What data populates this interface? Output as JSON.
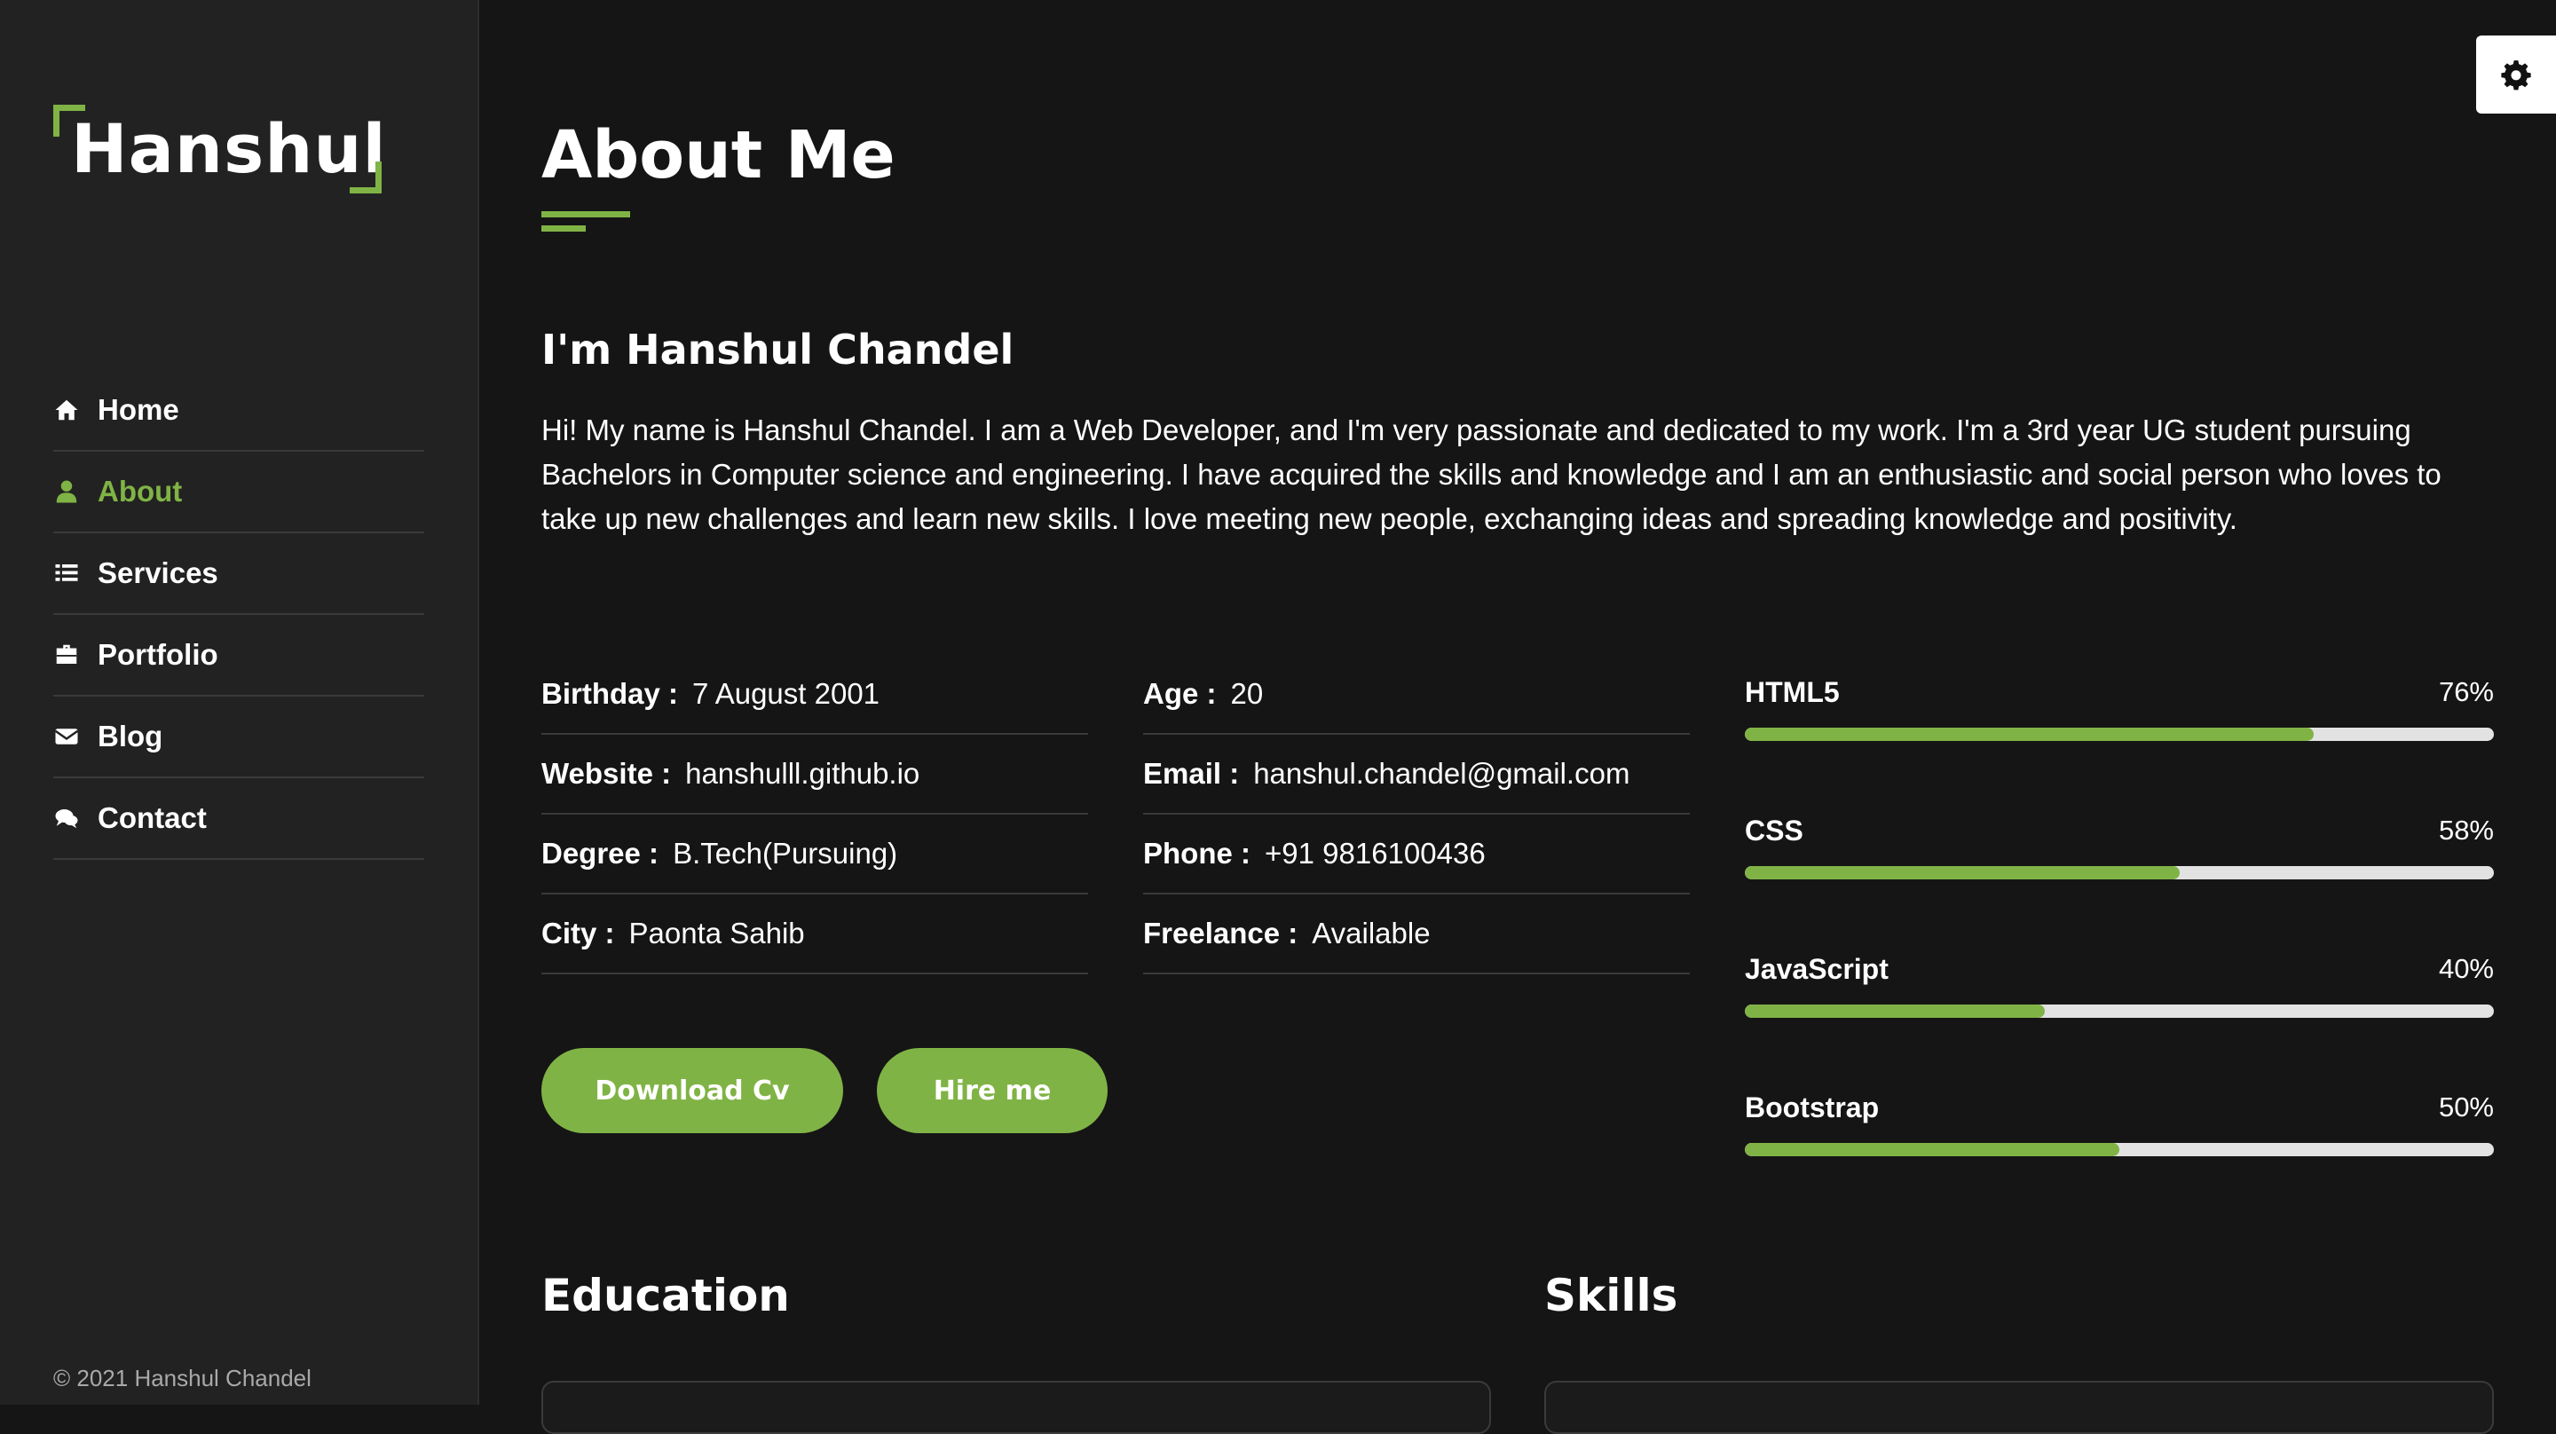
{
  "sidebar": {
    "logo": "Hanshul",
    "nav": [
      {
        "label": "Home",
        "icon": "home-icon"
      },
      {
        "label": "About",
        "icon": "user-icon",
        "active": true
      },
      {
        "label": "Services",
        "icon": "list-icon"
      },
      {
        "label": "Portfolio",
        "icon": "briefcase-icon"
      },
      {
        "label": "Blog",
        "icon": "envelope-icon"
      },
      {
        "label": "Contact",
        "icon": "comments-icon"
      }
    ],
    "copyright": "© 2021 Hanshul Chandel"
  },
  "settings": {
    "icon": "gear-icon"
  },
  "about": {
    "title": "About Me",
    "heading": "I'm Hanshul Chandel",
    "text": "Hi! My name is Hanshul Chandel. I am a Web Developer, and I'm very passionate and dedicated to my work. I'm a 3rd year UG student pursuing Bachelors in Computer science and engineering. I have acquired the skills and knowledge and I am an enthusiastic and social person who loves to take up new challenges and learn new skills. I love meeting new people, exchanging ideas and spreading knowledge and positivity.",
    "info_left": [
      {
        "label": "Birthday :",
        "value": "7 August 2001"
      },
      {
        "label": "Website :",
        "value": "hanshulll.github.io"
      },
      {
        "label": "Degree :",
        "value": "B.Tech(Pursuing)"
      },
      {
        "label": "City :",
        "value": "Paonta Sahib"
      }
    ],
    "info_right": [
      {
        "label": "Age :",
        "value": "20"
      },
      {
        "label": "Email :",
        "value": "hanshul.chandel@gmail.com"
      },
      {
        "label": "Phone :",
        "value": "+91 9816100436"
      },
      {
        "label": "Freelance :",
        "value": "Available"
      }
    ],
    "buttons": {
      "download": "Download Cv",
      "hire": "Hire me"
    },
    "skills": [
      {
        "name": "HTML5",
        "percent_label": "76%",
        "value": 76
      },
      {
        "name": "CSS",
        "percent_label": "58%",
        "value": 58
      },
      {
        "name": "JavaScript",
        "percent_label": "40%",
        "value": 40
      },
      {
        "name": "Bootstrap",
        "percent_label": "50%",
        "value": 50
      }
    ],
    "education_heading": "Education",
    "skills_heading": "Skills"
  },
  "colors": {
    "accent": "#80b345",
    "background": "#151515",
    "sidebar": "#222222"
  }
}
